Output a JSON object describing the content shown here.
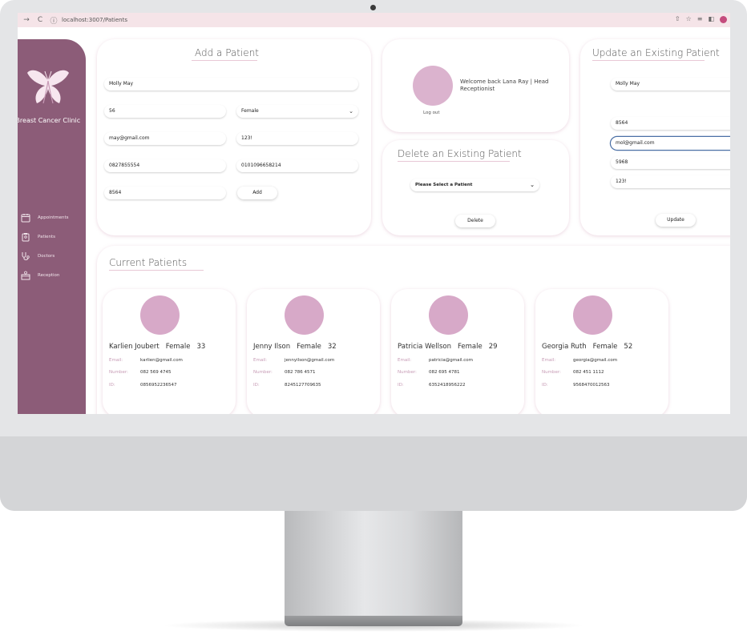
{
  "browser": {
    "url": "localhost:3007/Patients"
  },
  "sidebar": {
    "clinic_name": "The Breast Cancer Clinic",
    "items": [
      {
        "label": "Appointments",
        "icon": "calendar-icon"
      },
      {
        "label": "Patients",
        "icon": "clipboard-icon"
      },
      {
        "label": "Doctors",
        "icon": "stethoscope-icon"
      },
      {
        "label": "Reception",
        "icon": "reception-desk-icon"
      }
    ]
  },
  "add_patient": {
    "title": "Add a Patient",
    "name": "Molly May",
    "age": "56",
    "gender": "Female",
    "email": "may@gmail.com",
    "password": "123!",
    "phone": "0827855554",
    "id_number": "0101096658214",
    "patient_number": "8564",
    "add_label": "Add"
  },
  "welcome": {
    "text": "Welcome back Lana Ray | Head Receptionist",
    "logout": "Log out"
  },
  "delete_patient": {
    "title": "Delete an Existing Patient",
    "select_value": "Please Select a Patient",
    "delete_label": "Delete"
  },
  "update_patient": {
    "title": "Update an Existing Patient",
    "name": "Molly May",
    "patient_number": "8564",
    "email": "mol@gmail.com",
    "field_four": "5968",
    "password": "123!",
    "update_label": "Update"
  },
  "current_patients": {
    "title": "Current Patients",
    "labels": {
      "email": "Email:",
      "number": "Number:",
      "id": "ID:"
    },
    "patients": [
      {
        "name": "Karlien Joubert",
        "gender": "Female",
        "age": "33",
        "email": "karlien@gmail.com",
        "number": "082 569 4745",
        "id": "0856952236547"
      },
      {
        "name": "Jenny Ilson",
        "gender": "Female",
        "age": "32",
        "email": "jennyilson@gmail.com",
        "number": "082 786 4571",
        "id": "8245127709635"
      },
      {
        "name": "Patricia Wellson",
        "gender": "Female",
        "age": "29",
        "email": "patricia@gmail.com",
        "number": "082 695 4781",
        "id": "6352418956222"
      },
      {
        "name": "Georgia Ruth",
        "gender": "Female",
        "age": "52",
        "email": "georgia@gmail.com",
        "number": "082 451 1112",
        "id": "9568470012563"
      }
    ]
  },
  "colors": {
    "sidebar": "#8c5c78",
    "avatar": "#d7a9c8",
    "accent": "#c79bb5"
  }
}
